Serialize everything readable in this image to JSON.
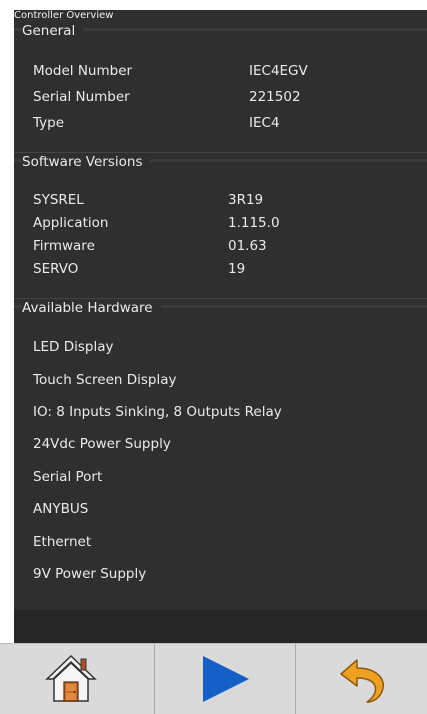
{
  "window": {
    "title": "Controller Overview"
  },
  "general": {
    "header": "General",
    "rows": [
      {
        "key": "Model Number",
        "value": "IEC4EGV"
      },
      {
        "key": "Serial Number",
        "value": "221502"
      },
      {
        "key": "Type",
        "value": "IEC4"
      }
    ]
  },
  "software": {
    "header": "Software Versions",
    "rows": [
      {
        "key": "SYSREL",
        "value": "3R19"
      },
      {
        "key": "Application",
        "value": "1.115.0"
      },
      {
        "key": "Firmware",
        "value": "01.63"
      },
      {
        "key": "SERVO",
        "value": "19"
      }
    ]
  },
  "hardware": {
    "header": "Available Hardware",
    "items": [
      "LED Display",
      "Touch Screen Display",
      "IO: 8 Inputs Sinking, 8 Outputs Relay",
      "24Vdc Power Supply",
      "Serial Port",
      "ANYBUS",
      "Ethernet",
      "9V Power Supply"
    ]
  },
  "toolbar": {
    "buttons": [
      {
        "icon": "home-icon"
      },
      {
        "icon": "play-icon"
      },
      {
        "icon": "undo-icon"
      }
    ]
  },
  "colors": {
    "panel_bg": "#2f2f2f",
    "text": "#eaeaea",
    "toolbar_bg": "#dadada",
    "play_blue": "#1560c8",
    "undo_orange": "#f0a020"
  }
}
